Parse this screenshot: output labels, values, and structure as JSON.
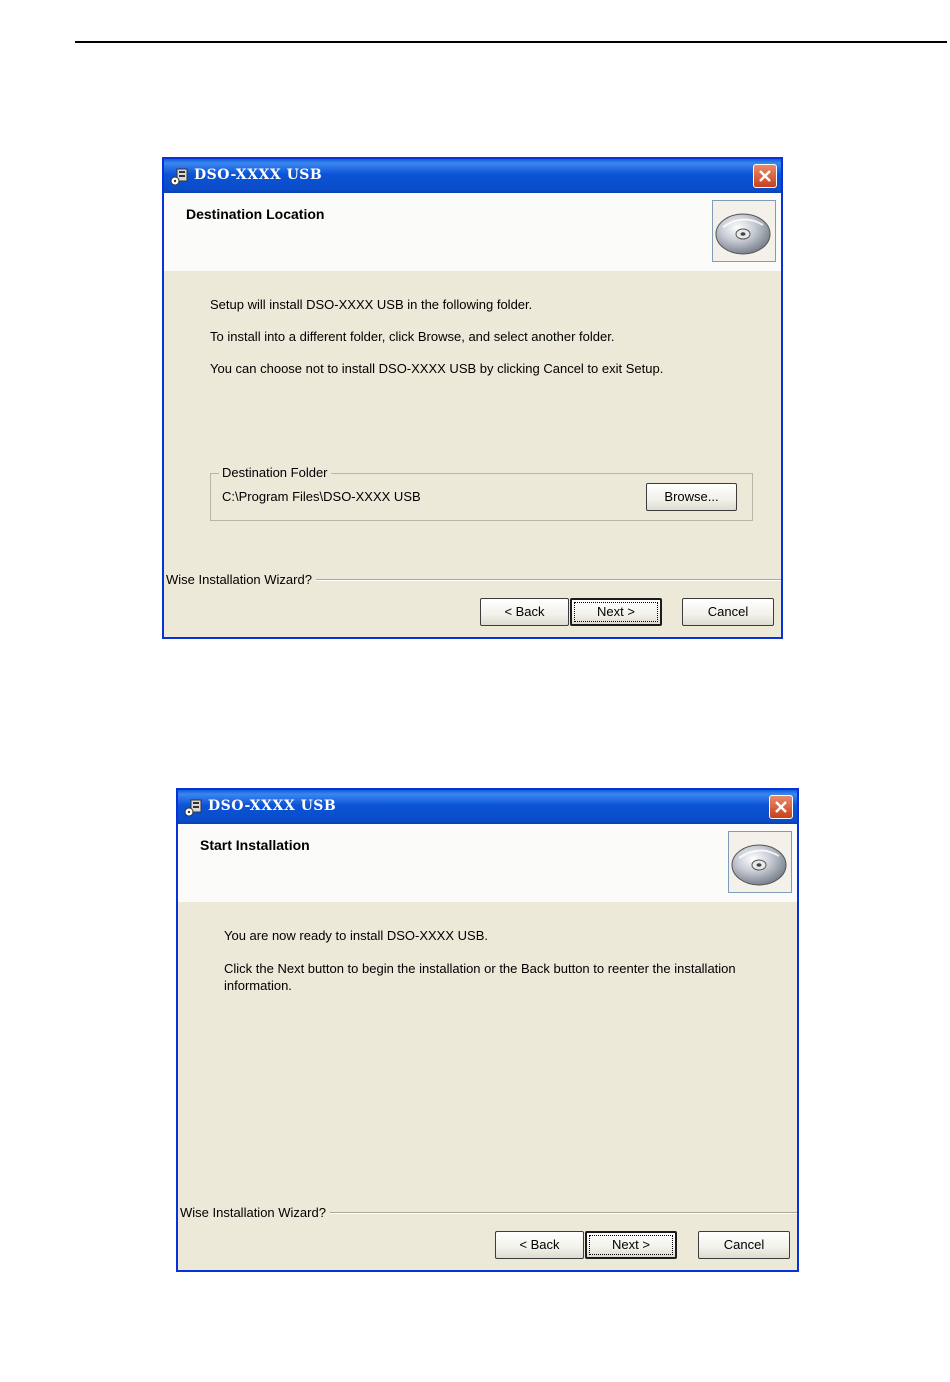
{
  "dialogs": [
    {
      "title": "DSO-XXXX USB",
      "header": "Destination Location",
      "lines": [
        "Setup will install DSO-XXXX USB in the following folder.",
        "To install into a different folder, click Browse, and select another folder.",
        "You can choose not to install DSO-XXXX USB by clicking Cancel to exit Setup."
      ],
      "group_label": "Destination Folder",
      "folder_path": "C:\\Program Files\\DSO-XXXX USB",
      "browse_label": "Browse...",
      "footer": "Wise Installation Wizard?",
      "back_label": "< Back",
      "next_label": "Next >",
      "cancel_label": "Cancel"
    },
    {
      "title": "DSO-XXXX USB",
      "header": "Start Installation",
      "lines": [
        "You are now ready to install DSO-XXXX USB.",
        "Click the Next button to begin the installation or the Back button to reenter the installation information."
      ],
      "footer": "Wise Installation Wizard?",
      "back_label": "< Back",
      "next_label": "Next >",
      "cancel_label": "Cancel"
    }
  ],
  "colors": {
    "titlebar": "#0a4cc8",
    "dialog_bg": "#ece9d8",
    "header_bg": "#fbfbf9",
    "close_button": "#c9401a"
  },
  "icons": {
    "title": "setup-app-icon",
    "close": "close-icon",
    "header": "cd-disc-icon"
  }
}
